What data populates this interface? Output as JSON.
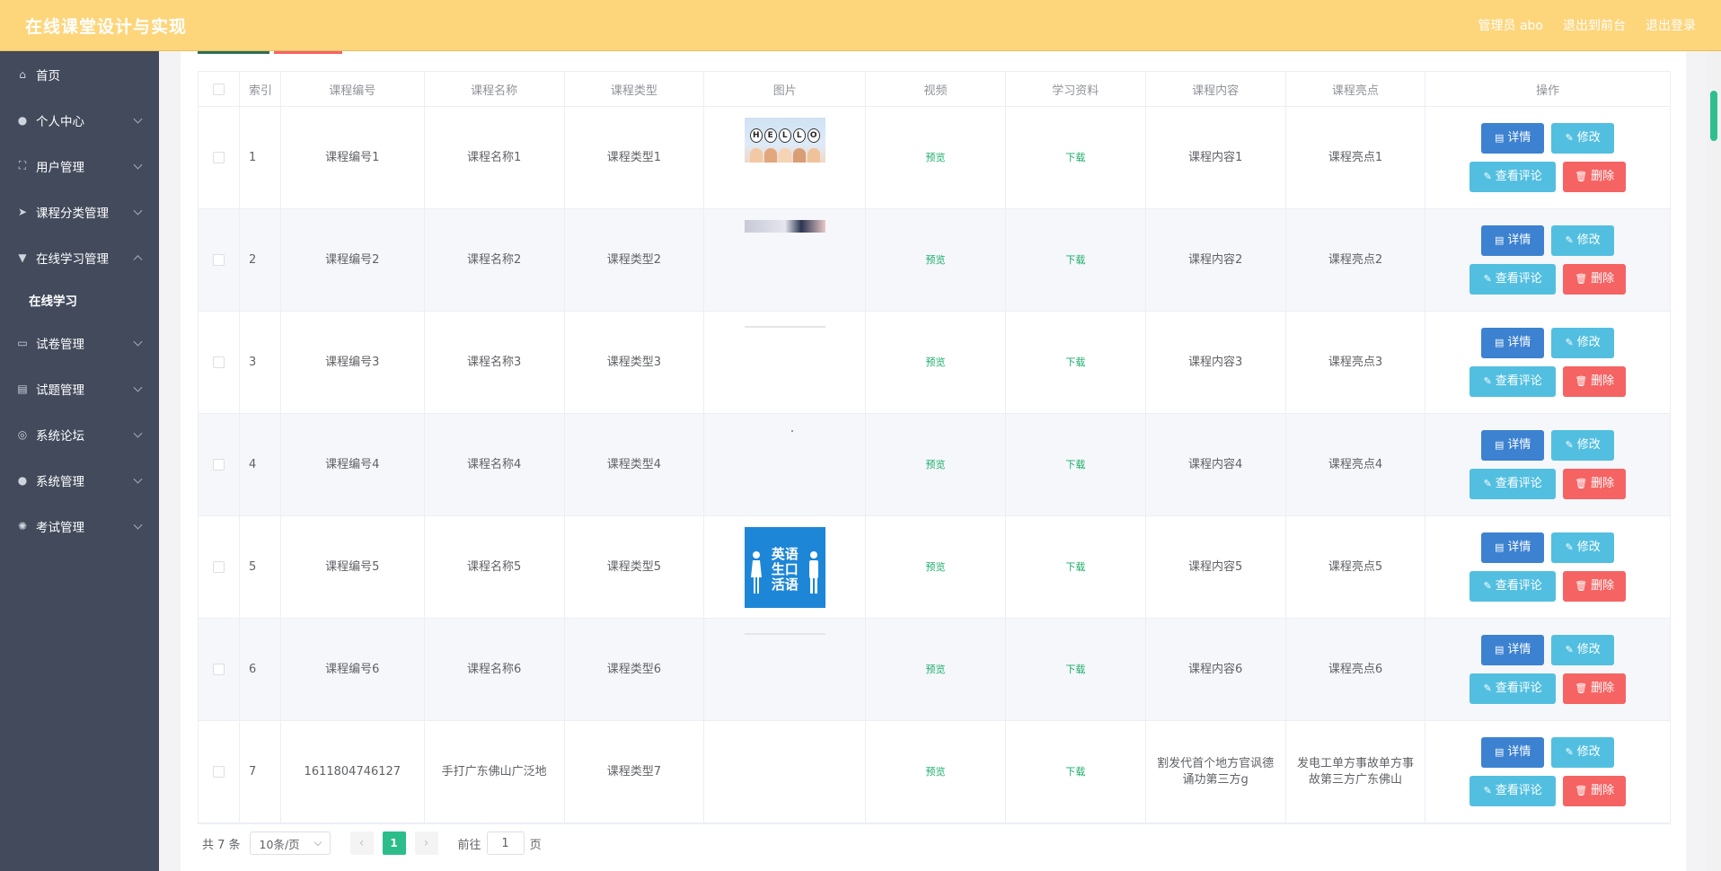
{
  "header": {
    "title": "在线课堂设计与实现",
    "admin": "管理员 abo",
    "front_link": "退出到前台",
    "logout": "退出登录",
    "bg_color": "#fdd57b"
  },
  "sidebar": {
    "items": [
      {
        "label": "首页",
        "icon": "home-icon",
        "arrow": false
      },
      {
        "label": "个人中心",
        "icon": "user-icon",
        "arrow": true
      },
      {
        "label": "用户管理",
        "icon": "frame-icon",
        "arrow": true
      },
      {
        "label": "课程分类管理",
        "icon": "send-icon",
        "arrow": true
      },
      {
        "label": "在线学习管理",
        "icon": "marker-icon",
        "arrow": true,
        "expanded": true
      },
      {
        "label": "试卷管理",
        "icon": "chat-icon",
        "arrow": true
      },
      {
        "label": "试题管理",
        "icon": "card-icon",
        "arrow": true
      },
      {
        "label": "系统论坛",
        "icon": "compass-icon",
        "arrow": true
      },
      {
        "label": "系统管理",
        "icon": "user-icon",
        "arrow": true
      },
      {
        "label": "考试管理",
        "icon": "aperture-icon",
        "arrow": true
      }
    ],
    "submenu_label": "在线学习"
  },
  "table": {
    "headers": [
      "",
      "索引",
      "课程编号",
      "课程名称",
      "课程类型",
      "图片",
      "视频",
      "学习资料",
      "课程内容",
      "课程亮点",
      "操作"
    ],
    "preview": "预览",
    "download": "下载",
    "buttons": {
      "detail": "详情",
      "edit": "修改",
      "comment": "查看评论",
      "delete": "删除"
    },
    "rows": [
      {
        "index": "1",
        "code": "课程编号1",
        "name": "课程名称1",
        "type": "课程类型1",
        "image": "hello",
        "content": "课程内容1",
        "highlight": "课程亮点1"
      },
      {
        "index": "2",
        "code": "课程编号2",
        "name": "课程名称2",
        "type": "课程类型2",
        "image": "strip",
        "content": "课程内容2",
        "highlight": "课程亮点2"
      },
      {
        "index": "3",
        "code": "课程编号3",
        "name": "课程名称3",
        "type": "课程类型3",
        "image": "line",
        "content": "课程内容3",
        "highlight": "课程亮点3"
      },
      {
        "index": "4",
        "code": "课程编号4",
        "name": "课程名称4",
        "type": "课程类型4",
        "image": "dot",
        "content": "课程内容4",
        "highlight": "课程亮点4"
      },
      {
        "index": "5",
        "code": "课程编号5",
        "name": "课程名称5",
        "type": "课程类型5",
        "image": "english",
        "content": "课程内容5",
        "highlight": "课程亮点5"
      },
      {
        "index": "6",
        "code": "课程编号6",
        "name": "课程名称6",
        "type": "课程类型6",
        "image": "line",
        "content": "课程内容6",
        "highlight": "课程亮点6"
      },
      {
        "index": "7",
        "code": "1611804746127",
        "name": "手打广东佛山广泛地",
        "type": "课程类型7",
        "image": "none",
        "content": "割发代首个地方官讽德诵功第三方g",
        "highlight": "发电工单方事故单方事故第三方广东佛山"
      }
    ]
  },
  "image_text": {
    "hello": "HELLO",
    "english": "英语生口活语"
  },
  "pagination": {
    "total": "共 7 条",
    "page_size": "10条/页",
    "current": "1",
    "goto_prefix": "前往",
    "goto_value": "1",
    "goto_suffix": "页"
  },
  "colors": {
    "sidebar": "#424a5b",
    "green_link": "#1cad6a",
    "detail": "#3c82d0",
    "edit": "#53bfe0",
    "delete": "#f56363",
    "page_active": "#2dbd8b"
  }
}
